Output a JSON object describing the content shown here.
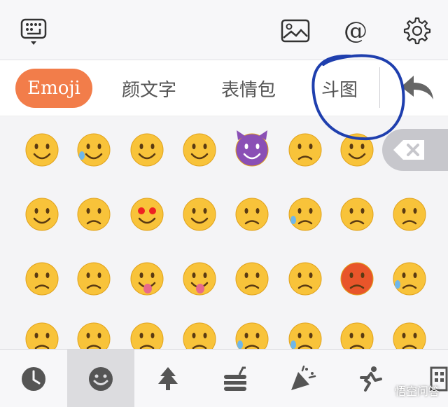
{
  "toolbar": {
    "icons": [
      "keyboard-icon",
      "image-icon",
      "at-icon",
      "gear-icon"
    ],
    "at_symbol": "@"
  },
  "tabs": [
    {
      "label": "Emoji",
      "active": true
    },
    {
      "label": "颜文字",
      "active": false
    },
    {
      "label": "表情包",
      "active": false
    },
    {
      "label": "斗图",
      "active": false
    }
  ],
  "undo_icon": "undo-icon",
  "backspace_icon": "backspace-icon",
  "emoji_rows": [
    [
      "grimacing",
      "joy",
      "smiley",
      "smile",
      "smiling-imp",
      "wink",
      "blush"
    ],
    [
      "relaxed",
      "relieved",
      "heart-eyes",
      "smirk",
      "unamused",
      "sweat",
      "pensive",
      "confounded"
    ],
    [
      "kissing-heart",
      "kissing-closed-eyes",
      "stuck-out-tongue-winking-eye",
      "stuck-out-tongue-closed-eyes",
      "disappointed",
      "angry",
      "rage",
      "cry"
    ],
    [
      "persevere",
      "disappointed-relieved",
      "fearful",
      "sleepy",
      "sob",
      "cold-sweat",
      "scream",
      "dizzy-face"
    ]
  ],
  "bottom_categories": [
    {
      "icon": "clock-icon",
      "active": false
    },
    {
      "icon": "smiley-icon",
      "active": true
    },
    {
      "icon": "tree-icon",
      "active": false
    },
    {
      "icon": "food-icon",
      "active": false
    },
    {
      "icon": "party-icon",
      "active": false
    },
    {
      "icon": "runner-icon",
      "active": false
    },
    {
      "icon": "building-icon",
      "active": false
    }
  ],
  "colors": {
    "accent": "#f27d4a",
    "emoji_yellow": "#f8c33a",
    "annotation": "#1f3fae"
  },
  "watermark": "悟空问答"
}
